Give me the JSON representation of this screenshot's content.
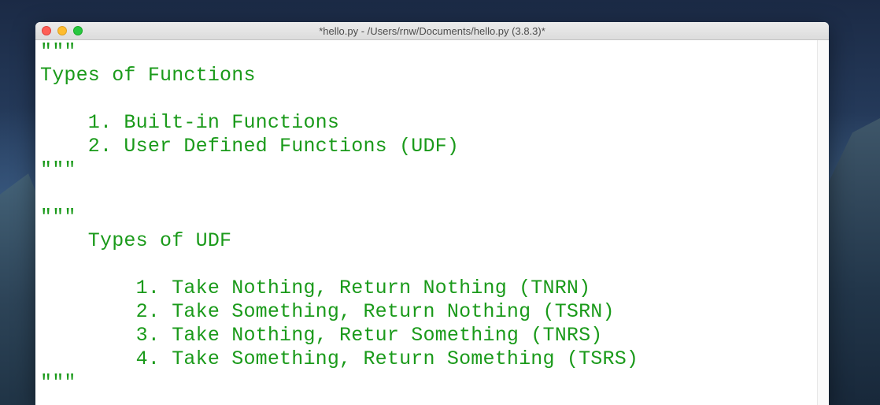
{
  "window": {
    "title": "*hello.py - /Users/rnw/Documents/hello.py (3.8.3)*"
  },
  "colors": {
    "string_green": "#1a9a1a",
    "editor_bg": "#ffffff",
    "close": "#fe5f57",
    "minimize": "#febc2e",
    "zoom": "#28c840"
  },
  "editor": {
    "lines": [
      "\"\"\"",
      "Types of Functions",
      "",
      "    1. Built-in Functions",
      "    2. User Defined Functions (UDF)",
      "\"\"\"",
      "",
      "\"\"\"",
      "    Types of UDF",
      "",
      "        1. Take Nothing, Return Nothing (TNRN)",
      "        2. Take Something, Return Nothing (TSRN)",
      "        3. Take Nothing, Retur Something (TNRS)",
      "        4. Take Something, Return Something (TSRS)",
      "\"\"\""
    ]
  }
}
